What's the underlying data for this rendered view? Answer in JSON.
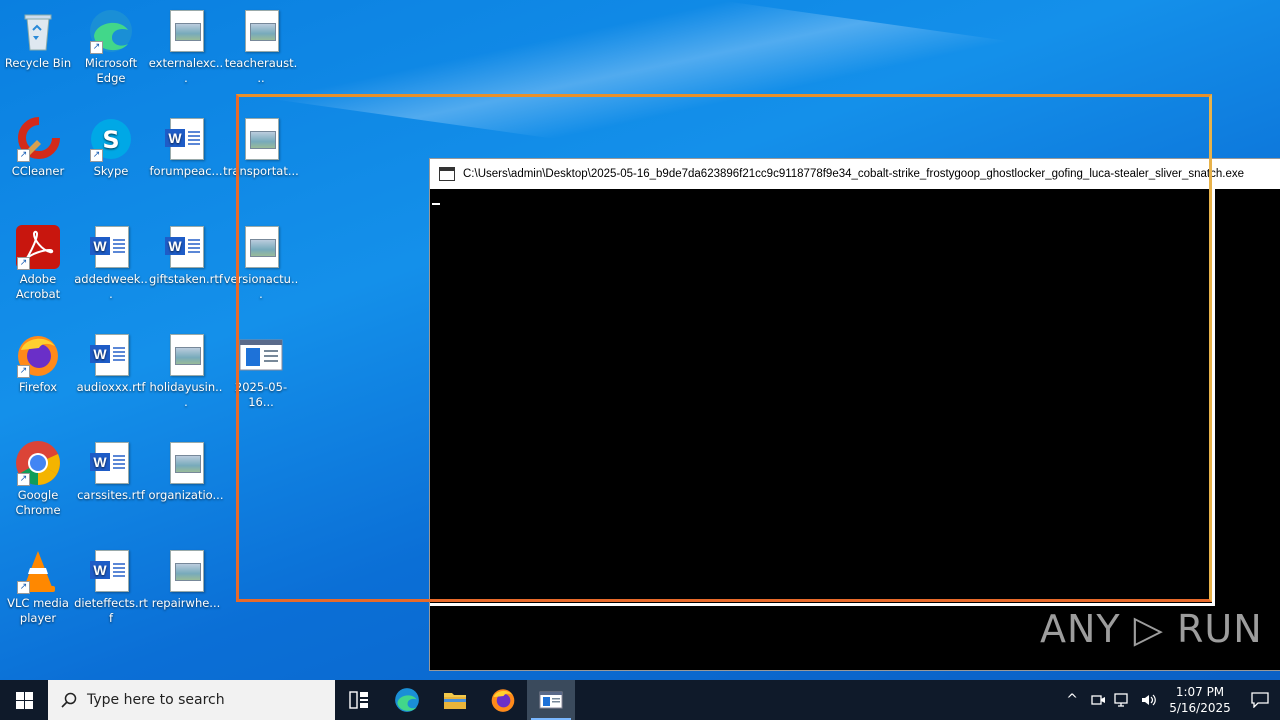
{
  "desktop": {
    "icons": [
      {
        "label": "Recycle Bin"
      },
      {
        "label": "Microsoft Edge"
      },
      {
        "label": "externalexc..."
      },
      {
        "label": "teacheraust..."
      },
      {
        "label": "CCleaner"
      },
      {
        "label": "Skype"
      },
      {
        "label": "forumpeac..."
      },
      {
        "label": "transportat..."
      },
      {
        "label": "Adobe Acrobat"
      },
      {
        "label": "addedweek..."
      },
      {
        "label": "giftstaken.rtf"
      },
      {
        "label": "versionactu..."
      },
      {
        "label": "Firefox"
      },
      {
        "label": "audioxxx.rtf"
      },
      {
        "label": "holidayusin..."
      },
      {
        "label": "2025-05-16..."
      },
      {
        "label": "Google Chrome"
      },
      {
        "label": "carssites.rtf"
      },
      {
        "label": "organizatio..."
      },
      {
        "label": "VLC media player"
      },
      {
        "label": "dieteffects.rtf"
      },
      {
        "label": "repairwhe..."
      }
    ]
  },
  "console": {
    "title": "C:\\Users\\admin\\Desktop\\2025-05-16_b9de7da623896f21cc9c9118778f9e34_cobalt-strike_frostygoop_ghostlocker_gofing_luca-stealer_sliver_snatch.exe"
  },
  "watermark": {
    "text": "ANY ▷ RUN"
  },
  "taskbar": {
    "search_placeholder": "Type here to search",
    "time": "1:07 PM",
    "date": "5/16/2025"
  },
  "colors": {
    "selection": "#e86a2a",
    "taskbar": "#0f1a2a",
    "accent": "#7ab8ff"
  }
}
